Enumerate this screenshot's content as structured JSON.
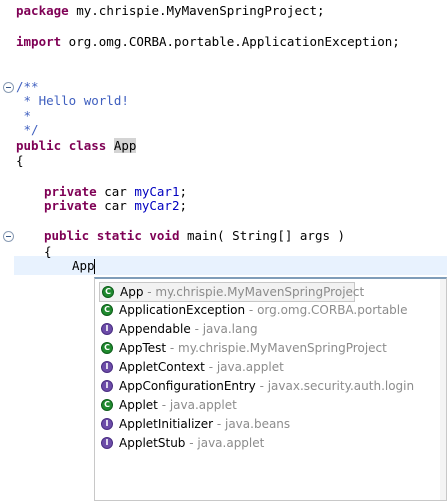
{
  "code": {
    "l1": {
      "kw": "package",
      "rest": " my.chrispie.MyMavenSpringProject;"
    },
    "l2": {
      "kw": "import",
      "rest": " org.omg.CORBA.portable.ApplicationException;"
    },
    "l3": "/**",
    "l4": " * Hello world!",
    "l5": " *",
    "l6": " */",
    "l7": {
      "kw1": "public",
      "kw2": "class",
      "name": "App"
    },
    "l8": "{",
    "l9": {
      "kw": "private",
      "type": " car ",
      "field": "myCar1",
      "end": ";"
    },
    "l10": {
      "kw": "private",
      "type": " car ",
      "field": "myCar2",
      "end": ";"
    },
    "l11": {
      "kw1": "public",
      "kw2": "static",
      "kw3": "void",
      "rest": " main( String[] args )"
    },
    "l12": "{",
    "l13": "App"
  },
  "completion": {
    "items": [
      {
        "icon": "class-icon",
        "name": "App",
        "package": " - my.chrispie.MyMavenSpringProject"
      },
      {
        "icon": "class-icon",
        "name": "ApplicationException",
        "package": " - org.omg.CORBA.portable"
      },
      {
        "icon": "interface-icon",
        "name": "Appendable",
        "package": " - java.lang"
      },
      {
        "icon": "class-icon",
        "name": "AppTest",
        "package": " - my.chrispie.MyMavenSpringProject"
      },
      {
        "icon": "interface-icon",
        "name": "AppletContext",
        "package": " - java.applet"
      },
      {
        "icon": "interface-icon",
        "name": "AppConfigurationEntry",
        "package": " - javax.security.auth.login"
      },
      {
        "icon": "class-icon",
        "name": "Applet",
        "package": " - java.applet"
      },
      {
        "icon": "interface-icon",
        "name": "AppletInitializer",
        "package": " - java.beans"
      },
      {
        "icon": "interface-icon",
        "name": "AppletStub",
        "package": " - java.applet"
      }
    ],
    "selected_index": 0
  },
  "colors": {
    "keyword": "#7f0055",
    "comment": "#3f5fbf",
    "field": "#0000c0",
    "class_icon": "#1f8a2e",
    "interface_icon": "#6c4ca8"
  }
}
